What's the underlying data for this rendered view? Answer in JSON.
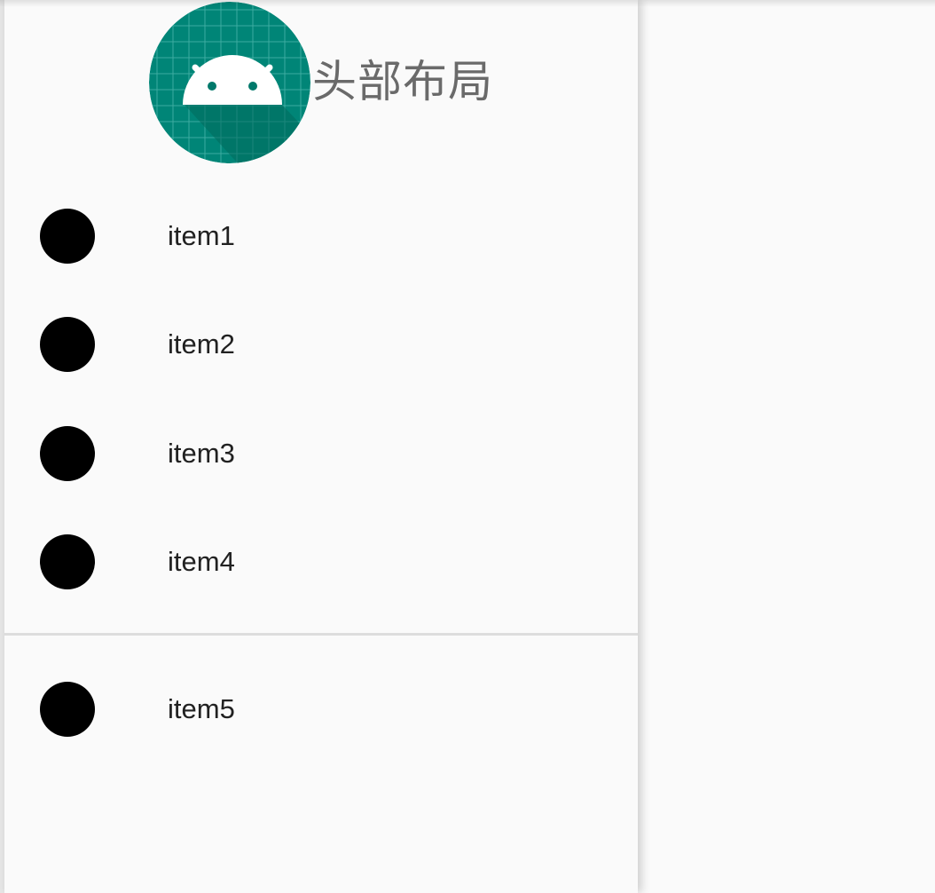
{
  "drawer": {
    "header": {
      "title": "头部布局",
      "avatar_icon": "android-launcher-icon"
    },
    "menu_group_1": [
      {
        "label": "item1",
        "icon": "dot-icon"
      },
      {
        "label": "item2",
        "icon": "dot-icon"
      },
      {
        "label": "item3",
        "icon": "dot-icon"
      },
      {
        "label": "item4",
        "icon": "dot-icon"
      }
    ],
    "menu_group_2": [
      {
        "label": "item5",
        "icon": "dot-icon"
      }
    ]
  },
  "colors": {
    "avatar_bg": "#00796b",
    "drawer_bg": "#fafafa",
    "icon": "#000000",
    "label": "#212121",
    "header_text": "#6a6a6a"
  }
}
